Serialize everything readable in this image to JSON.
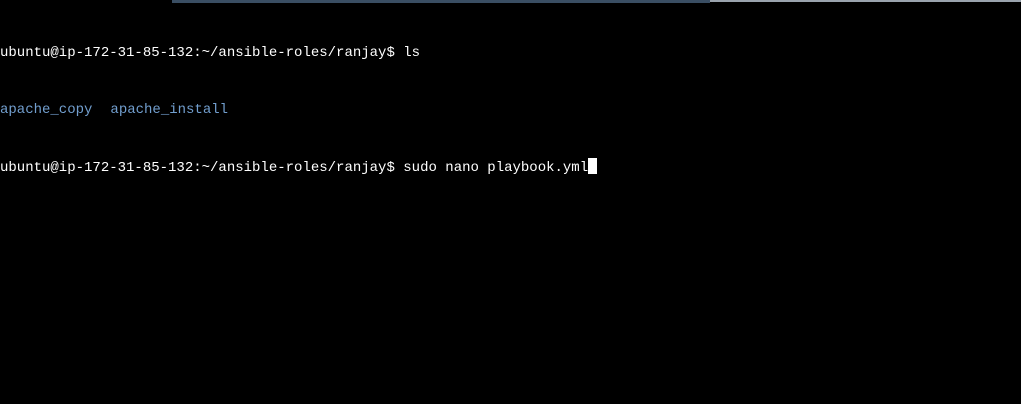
{
  "terminal": {
    "prompt": "ubuntu@ip-172-31-85-132:~/ansible-roles/ranjay$",
    "lines": [
      {
        "command": "ls"
      },
      {
        "output": [
          "apache_copy",
          "apache_install"
        ]
      },
      {
        "command": "sudo nano playbook.yml"
      }
    ],
    "colors": {
      "background": "#000000",
      "text": "#ffffff",
      "directory": "#729fcf"
    }
  }
}
